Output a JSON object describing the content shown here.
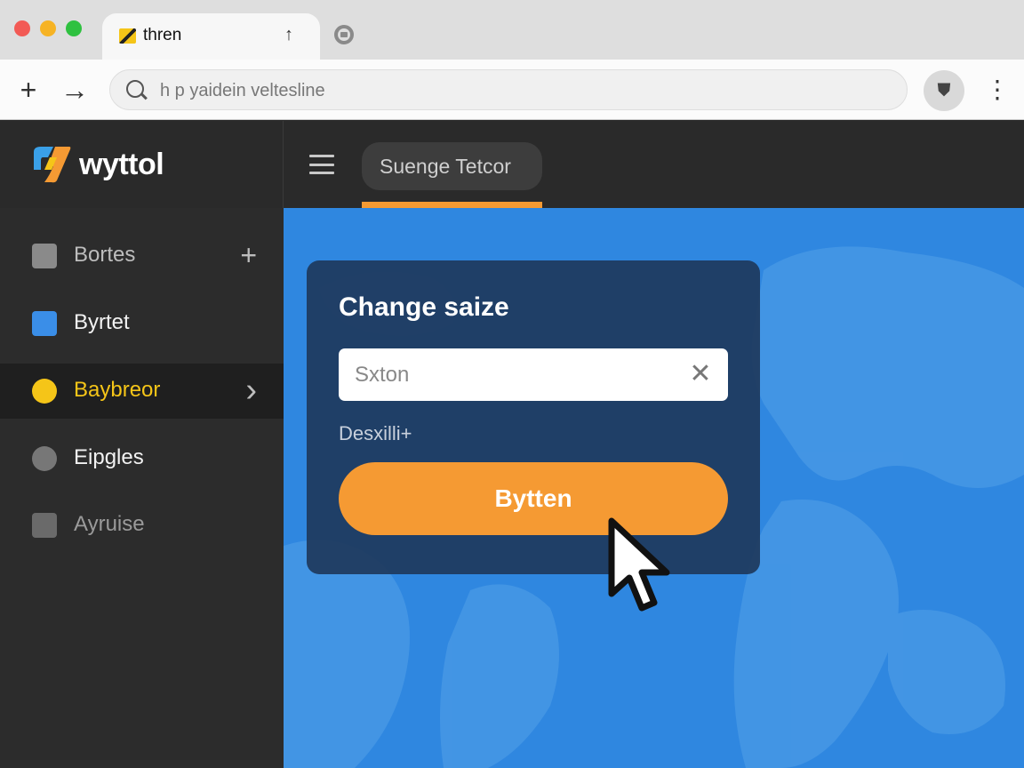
{
  "browser": {
    "tab_title": "thren",
    "tab_pin_glyph": "↑",
    "back_glyph": "+",
    "forward_glyph": "→",
    "address": "h p yaidein veltesline",
    "extension_glyph": "⛊",
    "menu_glyph": "⋮"
  },
  "app": {
    "brand_name": "wyttol",
    "header_tab_label": "Suenge Tetcor",
    "accent_color": "#f59a33",
    "map_color": "#2f87e0"
  },
  "sidebar": {
    "items": [
      {
        "label": "Bortes",
        "icon": "note-icon",
        "action": "+"
      },
      {
        "label": "Byrtet",
        "icon": "text-box-icon"
      },
      {
        "label": "Baybreor",
        "icon": "pie-chart-icon",
        "action": "›"
      },
      {
        "label": "Eipgles",
        "icon": "chat-bubble-icon"
      },
      {
        "label": "Ayruise",
        "icon": "frame-icon"
      }
    ]
  },
  "dialog": {
    "title": "Change saize",
    "input_value": "Sxton",
    "clear_glyph": "✕",
    "description": "Desxilli+",
    "button_label": "Bytten"
  }
}
